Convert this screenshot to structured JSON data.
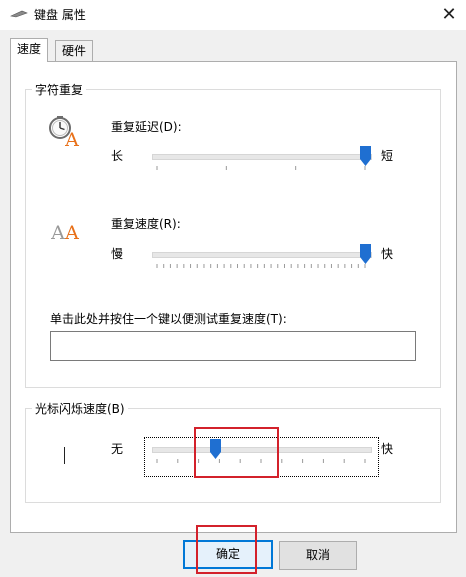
{
  "window": {
    "title": "键盘 属性",
    "close_glyph": "✕"
  },
  "tabs": [
    {
      "label": "速度",
      "active": true
    },
    {
      "label": "硬件",
      "active": false
    }
  ],
  "character_repeat": {
    "group_title": "字符重复",
    "repeat_delay": {
      "label": "重复延迟(D):",
      "min_label": "长",
      "max_label": "短",
      "value_fraction": 1.0,
      "tick_count": 4
    },
    "repeat_rate": {
      "label": "重复速度(R):",
      "min_label": "慢",
      "max_label": "快",
      "value_fraction": 1.0,
      "tick_count": 32
    },
    "test": {
      "label": "单击此处并按住一个键以便测试重复速度(T):",
      "value": ""
    }
  },
  "cursor_blink": {
    "group_title": "光标闪烁速度(B)",
    "min_label": "无",
    "max_label": "快",
    "value_fraction": 0.28,
    "tick_count": 11
  },
  "buttons": {
    "ok": "确定",
    "cancel": "取消"
  },
  "colors": {
    "accent": "#0078d7",
    "highlight_box": "#d3212b",
    "thumb": "#1f6fd1"
  }
}
